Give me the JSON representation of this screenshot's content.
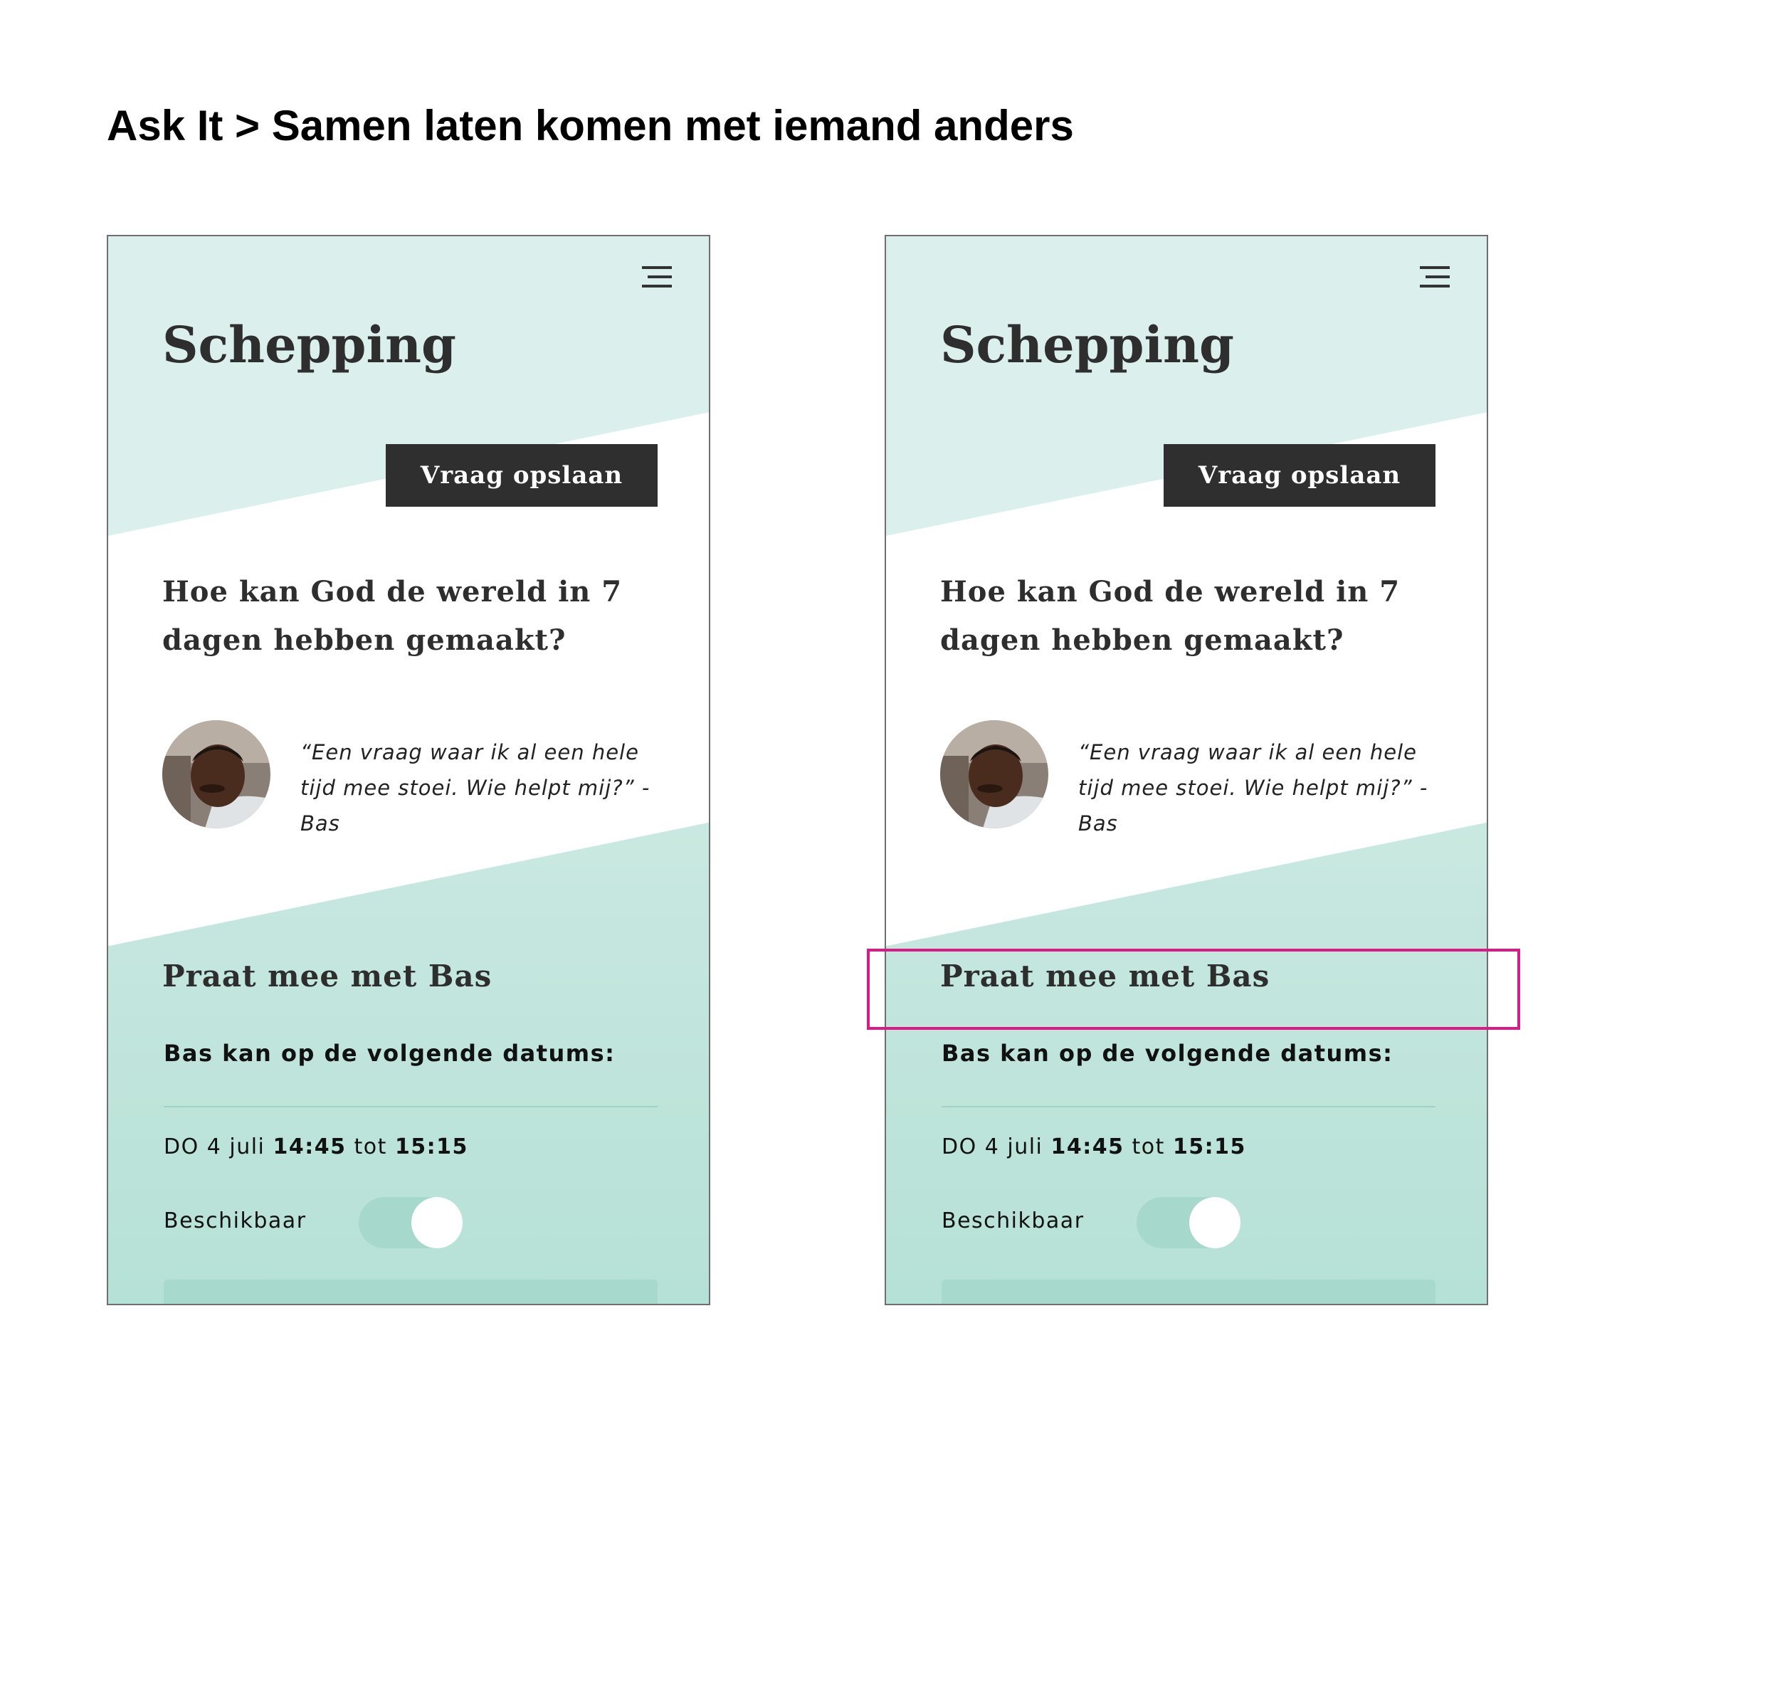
{
  "page": {
    "title": "Ask It > Samen laten komen met iemand anders"
  },
  "colors": {
    "top_band": "#dbf0ec",
    "bottom_band_top": "#c9e8e1",
    "bottom_band_bottom": "#b6e1d6",
    "button_bg": "#2f2f2f",
    "highlight": "#d81b87"
  },
  "screens": [
    {
      "app_title": "Schepping",
      "menu_icon": "hamburger-menu-icon",
      "save_button_label": "Vraag opslaan",
      "question": "Hoe kan God de wereld in 7 dagen hebben gemaakt?",
      "quote": "“Een vraag waar ik al een hele tijd mee stoei. Wie helpt mij?” - Bas",
      "section_title": "Praat mee met Bas",
      "dates_label": "Bas kan op de volgende datums:",
      "date": {
        "day": "DO 4 juli",
        "start": "14:45",
        "sep": "tot",
        "end": "15:15"
      },
      "available_label": "Beschikbaar",
      "available": true,
      "highlighted": false
    },
    {
      "app_title": "Schepping",
      "menu_icon": "hamburger-menu-icon",
      "save_button_label": "Vraag opslaan",
      "question": "Hoe kan God de wereld in 7 dagen hebben gemaakt?",
      "quote": "“Een vraag waar ik al een hele tijd mee stoei. Wie helpt mij?” - Bas",
      "section_title": "Praat mee met Bas",
      "dates_label": "Bas kan op de volgende datums:",
      "date": {
        "day": "DO 4 juli",
        "start": "14:45",
        "sep": "tot",
        "end": "15:15"
      },
      "available_label": "Beschikbaar",
      "available": true,
      "highlighted": true
    }
  ]
}
